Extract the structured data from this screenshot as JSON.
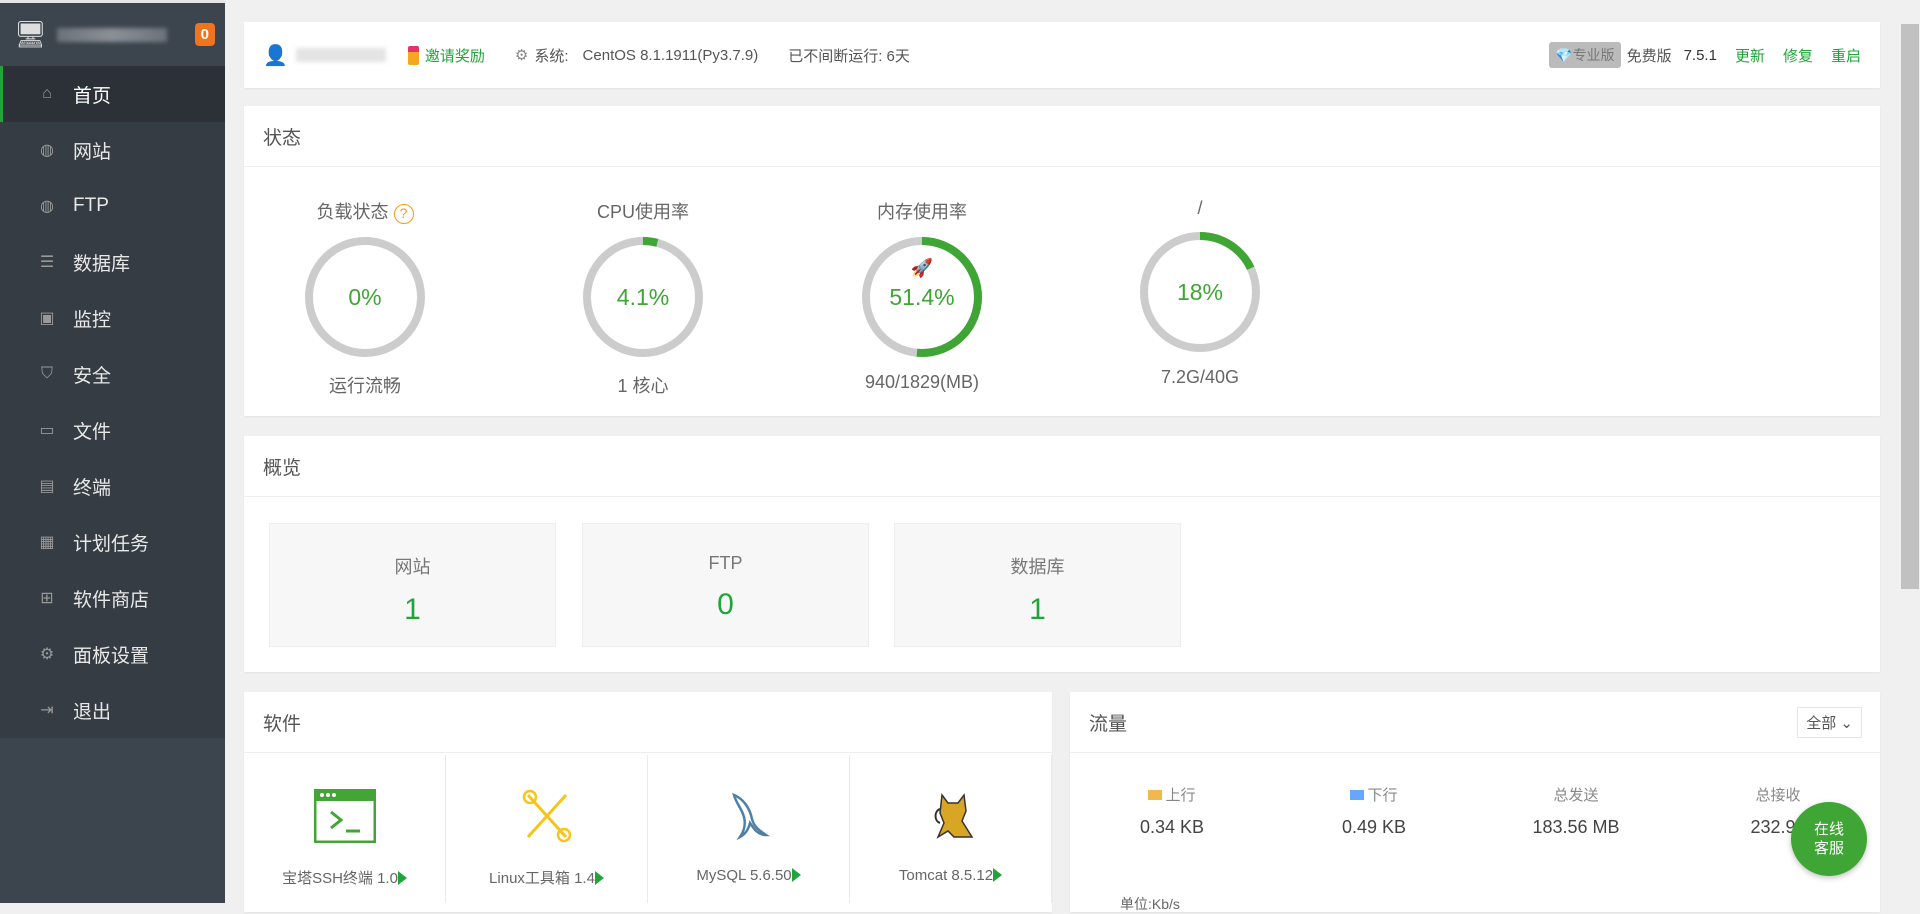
{
  "sidebar": {
    "badge": "0",
    "items": [
      {
        "label": "首页",
        "icon": "home-icon"
      },
      {
        "label": "网站",
        "icon": "globe-icon"
      },
      {
        "label": "FTP",
        "icon": "ftp-icon"
      },
      {
        "label": "数据库",
        "icon": "database-icon"
      },
      {
        "label": "监控",
        "icon": "monitor-icon"
      },
      {
        "label": "安全",
        "icon": "shield-icon"
      },
      {
        "label": "文件",
        "icon": "folder-icon"
      },
      {
        "label": "终端",
        "icon": "terminal-icon"
      },
      {
        "label": "计划任务",
        "icon": "calendar-icon"
      },
      {
        "label": "软件商店",
        "icon": "grid-icon"
      },
      {
        "label": "面板设置",
        "icon": "gear-icon"
      },
      {
        "label": "退出",
        "icon": "logout-icon"
      }
    ]
  },
  "header": {
    "invite": "邀请奖励",
    "system_label": "系统:",
    "system": "CentOS 8.1.1911(Py3.7.9)",
    "uptime": "已不间断运行: 6天",
    "pro": "专业版",
    "edition": "免费版",
    "version": "7.5.1",
    "update": "更新",
    "repair": "修复",
    "restart": "重启"
  },
  "status": {
    "title": "状态",
    "gauges": [
      {
        "title": "负载状态",
        "value": "0%",
        "fraction": 0,
        "bottom": "运行流畅"
      },
      {
        "title": "CPU使用率",
        "value": "4.1%",
        "fraction": 0.041,
        "bottom": "1 核心"
      },
      {
        "title": "内存使用率",
        "value": "51.4%",
        "fraction": 0.514,
        "bottom": "940/1829(MB)"
      },
      {
        "title": "/",
        "value": "18%",
        "fraction": 0.18,
        "bottom": "7.2G/40G"
      }
    ]
  },
  "overview": {
    "title": "概览",
    "cards": [
      {
        "name": "网站",
        "value": "1"
      },
      {
        "name": "FTP",
        "value": "0"
      },
      {
        "name": "数据库",
        "value": "1"
      }
    ]
  },
  "software": {
    "title": "软件",
    "items": [
      {
        "name": "宝塔SSH终端 1.0"
      },
      {
        "name": "Linux工具箱 1.4"
      },
      {
        "name": "MySQL 5.6.50"
      },
      {
        "name": "Tomcat 8.5.12"
      }
    ]
  },
  "traffic": {
    "title": "流量",
    "select": "全部",
    "up_label": "上行",
    "up": "0.34 KB",
    "down_label": "下行",
    "down": "0.49 KB",
    "sent_label": "总发送",
    "sent": "183.56 MB",
    "recv_label": "总接收",
    "recv": "232.94",
    "unit": "单位:Kb/s",
    "colors": {
      "up": "#f3b84b",
      "down": "#64a8ff"
    }
  },
  "chat": {
    "line1": "在线",
    "line2": "客服"
  }
}
